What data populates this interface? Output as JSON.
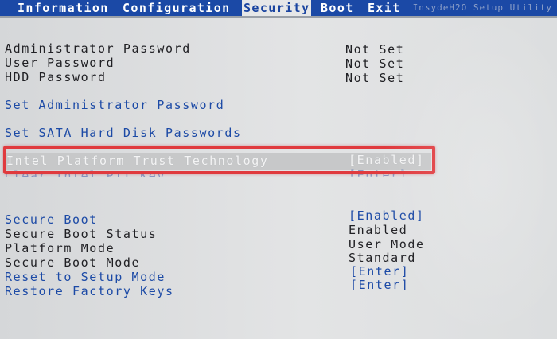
{
  "menu": {
    "tabs": [
      {
        "label": "Information"
      },
      {
        "label": "Configuration"
      },
      {
        "label": "Security"
      },
      {
        "label": "Boot"
      },
      {
        "label": "Exit"
      }
    ],
    "active": "Security",
    "right_text": "InsydeH2O Setup Utility"
  },
  "passwords": {
    "admin_label": "Administrator Password",
    "admin_value": "Not Set",
    "user_label": "User Password",
    "user_value": "Not Set",
    "hdd_label": "HDD Password",
    "hdd_value": "Not Set"
  },
  "actions": {
    "set_admin": "Set Administrator Password",
    "set_sata": "Set SATA Hard Disk Passwords"
  },
  "ptt": {
    "label": "Intel Platform Trust Technology",
    "value": "[Enabled]",
    "hidden_label": "Clear Intel PTT Key",
    "hidden_value": "[Enter]"
  },
  "secure_boot": {
    "secure_boot_label": "Secure Boot",
    "secure_boot_value": "[Enabled]",
    "status_label": "Secure Boot Status",
    "status_value": "Enabled",
    "platform_label": "Platform Mode",
    "platform_value": "User Mode",
    "mode_label": "Secure Boot Mode",
    "mode_value": "Standard",
    "reset_label": "Reset to Setup Mode",
    "reset_value": "[Enter]",
    "restore_label": "Restore Factory Keys",
    "restore_value": "[Enter]"
  },
  "colors": {
    "menu_bar": "#1b49a6",
    "background": "#dcdcdc",
    "link_blue": "#1c4aa6",
    "annotation_red": "#e03a3e"
  }
}
